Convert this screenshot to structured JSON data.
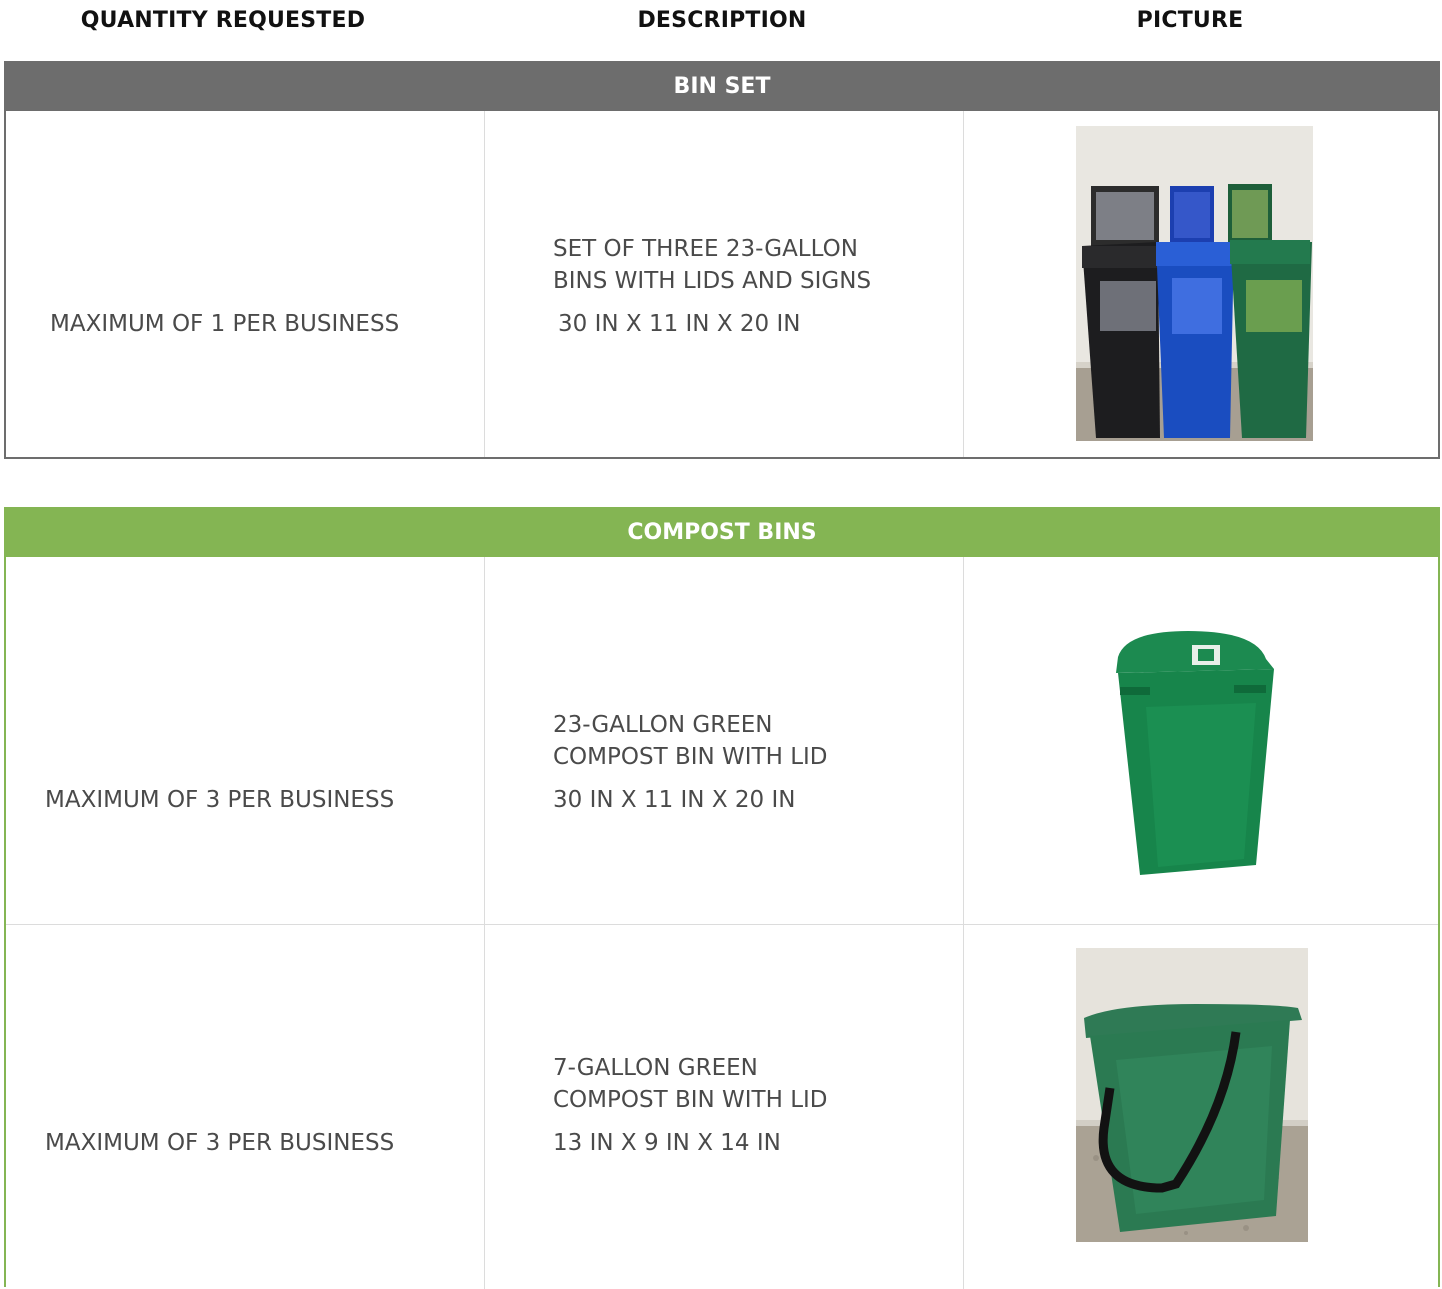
{
  "headers": {
    "quantity": "QUANTITY REQUESTED",
    "description": "DESCRIPTION",
    "picture": "PICTURE"
  },
  "colors": {
    "bin_set_band": "#6d6d6d",
    "compost_band": "#84b553"
  },
  "bin_set": {
    "title": "BIN SET",
    "rows": [
      {
        "quantity": "MAXIMUM OF 1 PER BUSINESS",
        "desc_line1": "SET OF THREE 23-GALLON",
        "desc_line2": "BINS WITH LIDS AND SIGNS",
        "dimensions": "30 IN X 11 IN X 20 IN"
      }
    ]
  },
  "compost": {
    "title": "COMPOST BINS",
    "rows": [
      {
        "quantity": "MAXIMUM OF 3 PER BUSINESS",
        "desc_line1": "23-GALLON GREEN",
        "desc_line2": "COMPOST BIN WITH LID",
        "dimensions": "30 IN X 11 IN X 20 IN"
      },
      {
        "quantity": "MAXIMUM OF 3 PER BUSINESS",
        "desc_line1": "7-GALLON GREEN",
        "desc_line2": "COMPOST BIN WITH LID",
        "dimensions": "13 IN X 9 IN X 14 IN"
      }
    ]
  }
}
